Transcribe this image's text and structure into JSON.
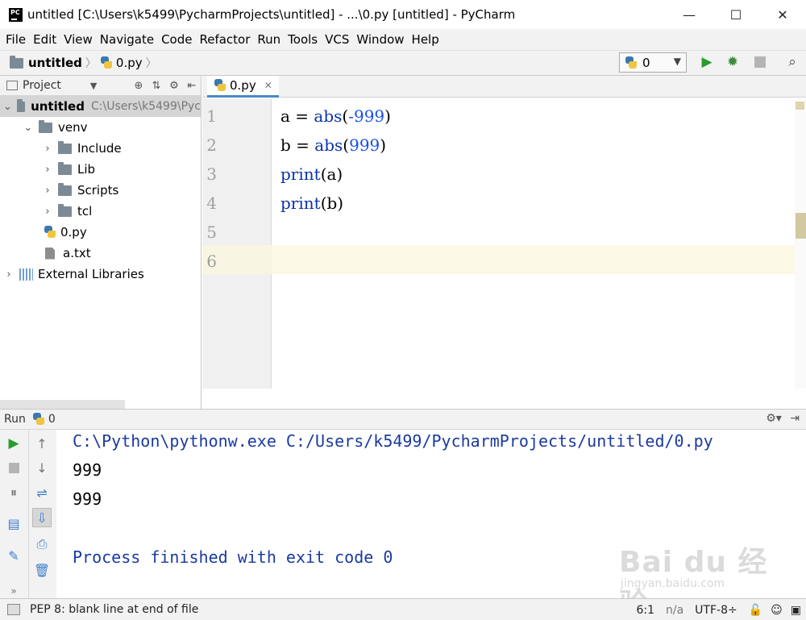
{
  "window": {
    "title": "untitled [C:\\Users\\k5499\\PycharmProjects\\untitled] - ...\\0.py [untitled] - PyCharm",
    "logo_text": "PC",
    "minimize": "—",
    "maximize": "☐",
    "close": "✕"
  },
  "menu": [
    "File",
    "Edit",
    "View",
    "Navigate",
    "Code",
    "Refactor",
    "Run",
    "Tools",
    "VCS",
    "Window",
    "Help"
  ],
  "navbar": {
    "project": "untitled",
    "file": "0.py",
    "run_config": "0"
  },
  "project_panel": {
    "header": "Project",
    "tree": [
      {
        "label": "untitled",
        "path": "C:\\Users\\k5499\\Pyc"
      },
      {
        "label": "venv"
      },
      {
        "label": "Include"
      },
      {
        "label": "Lib"
      },
      {
        "label": "Scripts"
      },
      {
        "label": "tcl"
      },
      {
        "label": "0.py"
      },
      {
        "label": "a.txt"
      },
      {
        "label": "External Libraries"
      }
    ]
  },
  "editor": {
    "tab": "0.py",
    "line_numbers": [
      "1",
      "2",
      "3",
      "4",
      "5",
      "6"
    ],
    "code": {
      "l1": {
        "a": "a = ",
        "fn": "abs",
        "open": "(",
        "arg": "-999",
        "close": ")"
      },
      "l2": {
        "a": "b = ",
        "fn": "abs",
        "open": "(",
        "arg": "999",
        "close": ")"
      },
      "l3": {
        "fn": "print",
        "rest": "(a)"
      },
      "l4": {
        "fn": "print",
        "rest": "(b)"
      }
    }
  },
  "run_panel": {
    "label": "Run",
    "config": "0",
    "output": [
      "C:\\Python\\pythonw.exe C:/Users/k5499/PycharmProjects/untitled/0.py",
      "999",
      "999",
      "",
      "Process finished with exit code 0"
    ]
  },
  "watermark": {
    "main": "Bai du 经验",
    "sub": "jingyan.baidu.com"
  },
  "statusbar": {
    "message": "PEP 8: blank line at end of file",
    "position": "6:1",
    "line_sep": "n/a",
    "encoding": "UTF-8÷"
  },
  "colors": {
    "keyword": "#0a33a8",
    "number": "#1750eb",
    "console_blue": "#1b3a9e",
    "selection": "#d5d5d5",
    "current_line": "#fcfae6"
  }
}
